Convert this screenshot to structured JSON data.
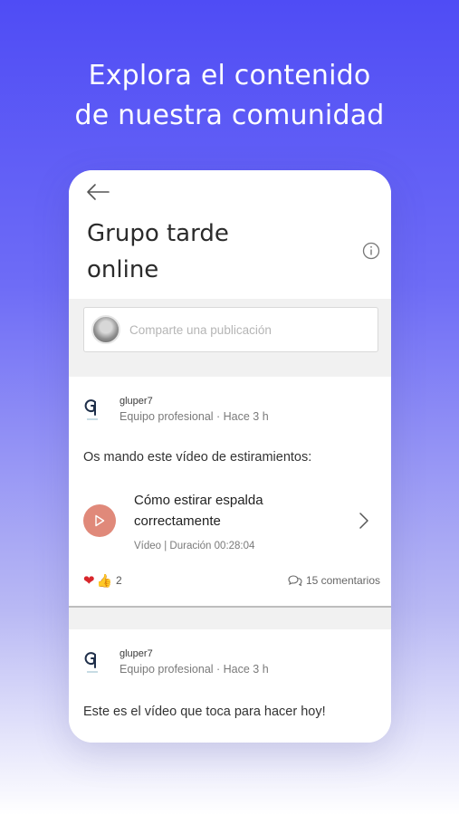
{
  "headline": {
    "line1": "Explora el contenido",
    "line2": "de nuestra comunidad"
  },
  "header": {
    "title_line1": "Grupo tarde",
    "title_line2": "online"
  },
  "composer": {
    "placeholder": "Comparte una publicación"
  },
  "posts": [
    {
      "author": "gluper7",
      "meta": "Equipo profesional · Hace 3 h",
      "text": "Os mando este vídeo de estiramientos:",
      "video": {
        "title": "Cómo estirar espalda correctamente",
        "meta": "Vídeo | Duración 00:28:04"
      },
      "reaction_count": "2",
      "comments": "15 comentarios"
    },
    {
      "author": "gluper7",
      "meta": "Equipo profesional · Hace 3 h",
      "text": "Este es el vídeo que toca para hacer hoy!"
    }
  ],
  "colors": {
    "play_button": "#e0897a",
    "accent": "#4f4cf5"
  }
}
